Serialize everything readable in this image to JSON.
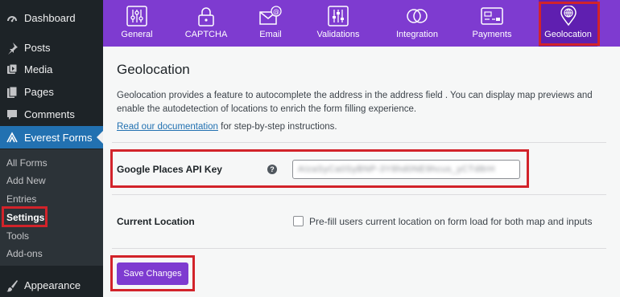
{
  "sidebar": {
    "items": [
      {
        "label": "Dashboard",
        "icon": "dashboard-icon"
      },
      {
        "label": "Posts",
        "icon": "pin-icon"
      },
      {
        "label": "Media",
        "icon": "media-icon"
      },
      {
        "label": "Pages",
        "icon": "pages-icon"
      },
      {
        "label": "Comments",
        "icon": "comment-icon"
      },
      {
        "label": "Everest Forms",
        "icon": "everest-forms-icon"
      },
      {
        "label": "Appearance",
        "icon": "brush-icon"
      }
    ],
    "submenu": [
      "All Forms",
      "Add New",
      "Entries",
      "Settings",
      "Tools",
      "Add-ons"
    ],
    "current_submenu": "Settings"
  },
  "tabs": [
    {
      "label": "General",
      "icon": "sliders-icon"
    },
    {
      "label": "CAPTCHA",
      "icon": "lock-icon"
    },
    {
      "label": "Email",
      "icon": "envelope-at-icon"
    },
    {
      "label": "Validations",
      "icon": "validations-icon"
    },
    {
      "label": "Integration",
      "icon": "rings-icon"
    },
    {
      "label": "Payments",
      "icon": "card-icon"
    },
    {
      "label": "Geolocation",
      "icon": "globe-pin-icon"
    }
  ],
  "active_tab": "Geolocation",
  "main": {
    "title": "Geolocation",
    "description": "Geolocation provides a feature to autocomplete the address in the address field . You can display map previews and enable the autodetection of locations to enrich the form filling experience.",
    "doc_link": "Read our documentation",
    "doc_suffix": " for step-by-step instructions.",
    "api_key_label": "Google Places API Key",
    "api_key_value": "AIzaSyCa0SyBNP-3Y8hd0NE9hcus_yCTd8rH",
    "help_glyph": "?",
    "location_label": "Current Location",
    "location_checkbox_label": "Pre-fill users current location on form load for both map and inputs",
    "location_checked": false,
    "save_label": "Save Changes"
  },
  "colors": {
    "brand_purple": "#7e3bd0",
    "active_tab": "#5f1fb0",
    "highlight_red": "#d2232a",
    "wp_blue": "#2271b1",
    "sidebar_bg": "#1d2327"
  }
}
